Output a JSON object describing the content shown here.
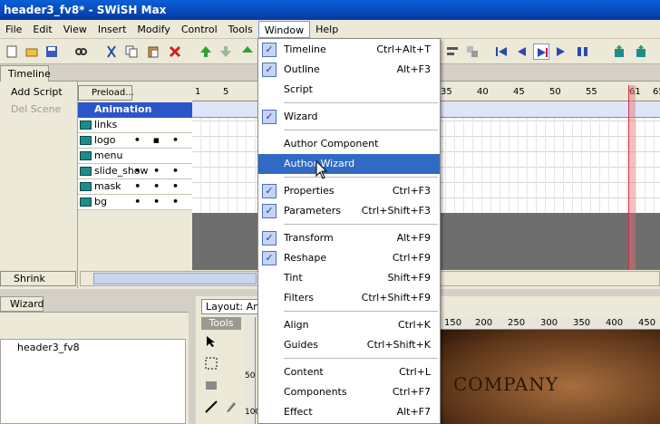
{
  "window": {
    "title": "header3_fv8* - SWiSH Max"
  },
  "menubar": {
    "items": [
      {
        "label": "File",
        "active": false
      },
      {
        "label": "Edit",
        "active": false
      },
      {
        "label": "View",
        "active": false
      },
      {
        "label": "Insert",
        "active": false
      },
      {
        "label": "Modify",
        "active": false
      },
      {
        "label": "Control",
        "active": false
      },
      {
        "label": "Tools",
        "active": false
      },
      {
        "label": "Window",
        "active": true
      },
      {
        "label": "Help",
        "active": false
      }
    ]
  },
  "timeline": {
    "tab_label": "Timeline",
    "add_script": "Add Script",
    "del_scene": "Del Scene",
    "preload": "Preload...",
    "scene_label": "Animation",
    "layers": [
      "links",
      "logo",
      "menu",
      "slide_show",
      "mask",
      "bg"
    ],
    "ruler": [
      "1",
      "5",
      "35",
      "40",
      "45",
      "50",
      "55",
      "61",
      "65"
    ],
    "shrink": "Shrink"
  },
  "wizard": {
    "tab_label": "Wizard",
    "tree_node": "header3_fv8"
  },
  "layout": {
    "tab_label": "Layout: An",
    "tools_label": "Tools",
    "ruler": [
      "150",
      "200",
      "250",
      "300",
      "350",
      "400",
      "450"
    ],
    "vruler": [
      "50",
      "100"
    ],
    "stage_text": "COMPANY"
  },
  "window_menu": {
    "items": [
      {
        "label": "Timeline",
        "shortcut": "Ctrl+Alt+T",
        "checked": true
      },
      {
        "label": "Outline",
        "shortcut": "Alt+F3",
        "checked": true
      },
      {
        "label": "Script",
        "shortcut": "",
        "checked": false
      },
      {
        "label": "Wizard",
        "shortcut": "",
        "checked": true
      },
      {
        "label": "Author Component",
        "shortcut": "",
        "checked": false
      },
      {
        "label": "Author Wizard",
        "shortcut": "",
        "checked": false,
        "highlighted": true
      },
      {
        "label": "Properties",
        "shortcut": "Ctrl+F3",
        "checked": true
      },
      {
        "label": "Parameters",
        "shortcut": "Ctrl+Shift+F3",
        "checked": true
      },
      {
        "label": "Transform",
        "shortcut": "Alt+F9",
        "checked": true
      },
      {
        "label": "Reshape",
        "shortcut": "Ctrl+F9",
        "checked": true
      },
      {
        "label": "Tint",
        "shortcut": "Shift+F9",
        "checked": false
      },
      {
        "label": "Filters",
        "shortcut": "Ctrl+Shift+F9",
        "checked": false
      },
      {
        "label": "Align",
        "shortcut": "Ctrl+K",
        "checked": false
      },
      {
        "label": "Guides",
        "shortcut": "Ctrl+Shift+K",
        "checked": false
      },
      {
        "label": "Content",
        "shortcut": "Ctrl+L",
        "checked": false
      },
      {
        "label": "Components",
        "shortcut": "Ctrl+F7",
        "checked": false
      },
      {
        "label": "Effect",
        "shortcut": "Alt+F7",
        "checked": false
      }
    ]
  },
  "colors": {
    "titlebar": "#0a5fd8",
    "highlight": "#316ac5",
    "scene": "#2b55c8"
  }
}
